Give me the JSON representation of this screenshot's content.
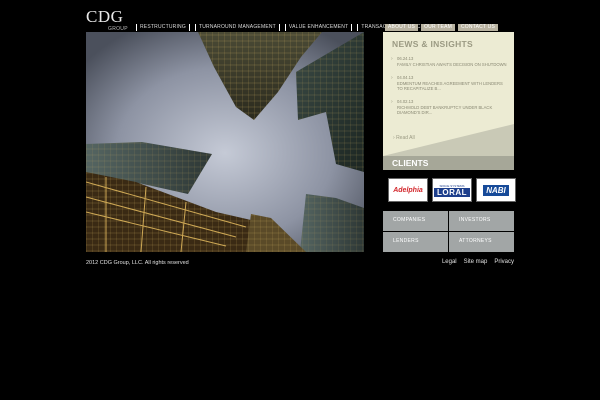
{
  "logo": {
    "main": "CDG",
    "sub": "GROUP"
  },
  "nav_main": [
    "RESTRUCTURING",
    "TURNAROUND MANAGEMENT",
    "VALUE ENHANCEMENT",
    "TRANSACTION SERVICES"
  ],
  "nav_sub": [
    "ABOUT US",
    "OUR TEAM",
    "CONTACT US"
  ],
  "news": {
    "title": "NEWS & INSIGHTS",
    "items": [
      {
        "date": "06.24.13",
        "text": "FAMILY CHRISTIAN AWAITS DECISION ON SHUTDOWN"
      },
      {
        "date": "04.04.13",
        "text": "EDMENTUM REACHES AGREEMENT WITH LENDERS TO RECAPITALIZE B..."
      },
      {
        "date": "04.02.13",
        "text": "RICHMOLD DEBT BANKRUPTCY UNDER BLACK DIAMOND'S DIR..."
      }
    ],
    "read_all": "Read All"
  },
  "clients": {
    "title": "CLIENTS",
    "logos": [
      {
        "name": "Adelphia"
      },
      {
        "top": "SPACE SYSTEMS",
        "name": "LORAL"
      },
      {
        "name": "NABI"
      }
    ]
  },
  "categories": [
    "COMPANIES",
    "INVESTORS",
    "LENDERS",
    "ATTORNEYS"
  ],
  "footer": {
    "copyright": "2012 CDG Group, LLC. All rights reserved",
    "links": [
      "Legal",
      "Site map",
      "Privacy"
    ]
  },
  "colors": {
    "background": "#000000",
    "news_panel": "#ecebd3",
    "clients_header": "#a6a798",
    "category_button": "#a2a6a6",
    "nav_sub": "#b9b3a1"
  }
}
